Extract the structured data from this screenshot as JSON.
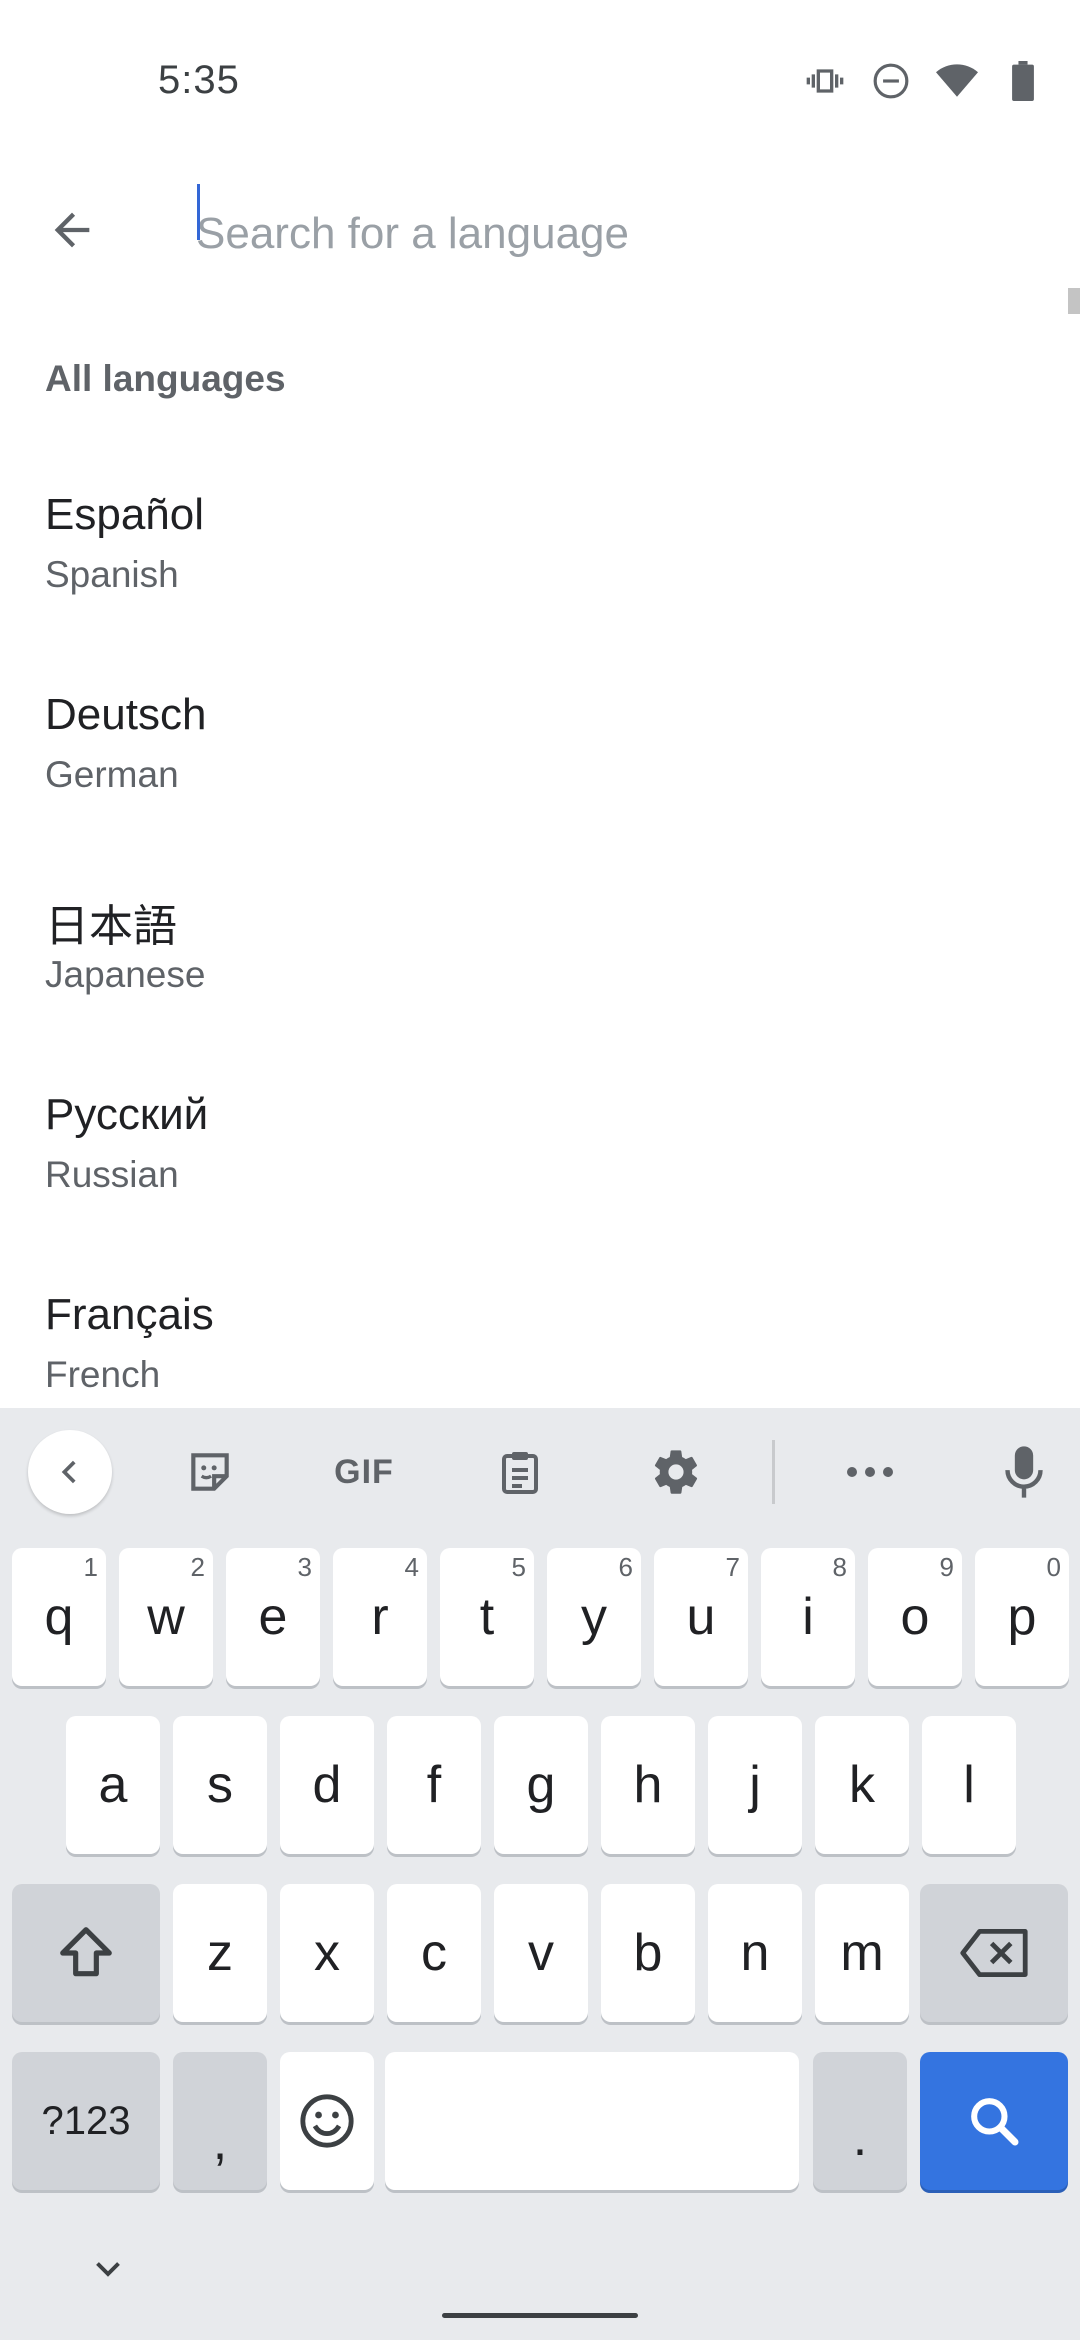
{
  "status_bar": {
    "time": "5:35",
    "icons": [
      "vibrate-icon",
      "dnd-icon",
      "wifi-icon",
      "battery-icon"
    ]
  },
  "search": {
    "placeholder": "Search for a language",
    "value": ""
  },
  "section": {
    "title": "All languages"
  },
  "languages": [
    {
      "native": "Español",
      "english": "Spanish"
    },
    {
      "native": "Deutsch",
      "english": "German"
    },
    {
      "native": "日本語",
      "english": "Japanese"
    },
    {
      "native": "Русский",
      "english": "Russian"
    },
    {
      "native": "Français",
      "english": "French"
    }
  ],
  "keyboard": {
    "toolbar": {
      "gif_label": "GIF"
    },
    "row1": [
      {
        "key": "q",
        "hint": "1"
      },
      {
        "key": "w",
        "hint": "2"
      },
      {
        "key": "e",
        "hint": "3"
      },
      {
        "key": "r",
        "hint": "4"
      },
      {
        "key": "t",
        "hint": "5"
      },
      {
        "key": "y",
        "hint": "6"
      },
      {
        "key": "u",
        "hint": "7"
      },
      {
        "key": "i",
        "hint": "8"
      },
      {
        "key": "o",
        "hint": "9"
      },
      {
        "key": "p",
        "hint": "0"
      }
    ],
    "row2": [
      "a",
      "s",
      "d",
      "f",
      "g",
      "h",
      "j",
      "k",
      "l"
    ],
    "row3": [
      "z",
      "x",
      "c",
      "v",
      "b",
      "n",
      "m"
    ],
    "symbols_label": "?123",
    "comma": ",",
    "period": ".",
    "colors": {
      "action_key": "#3474e0",
      "background": "#e8eaed"
    }
  }
}
